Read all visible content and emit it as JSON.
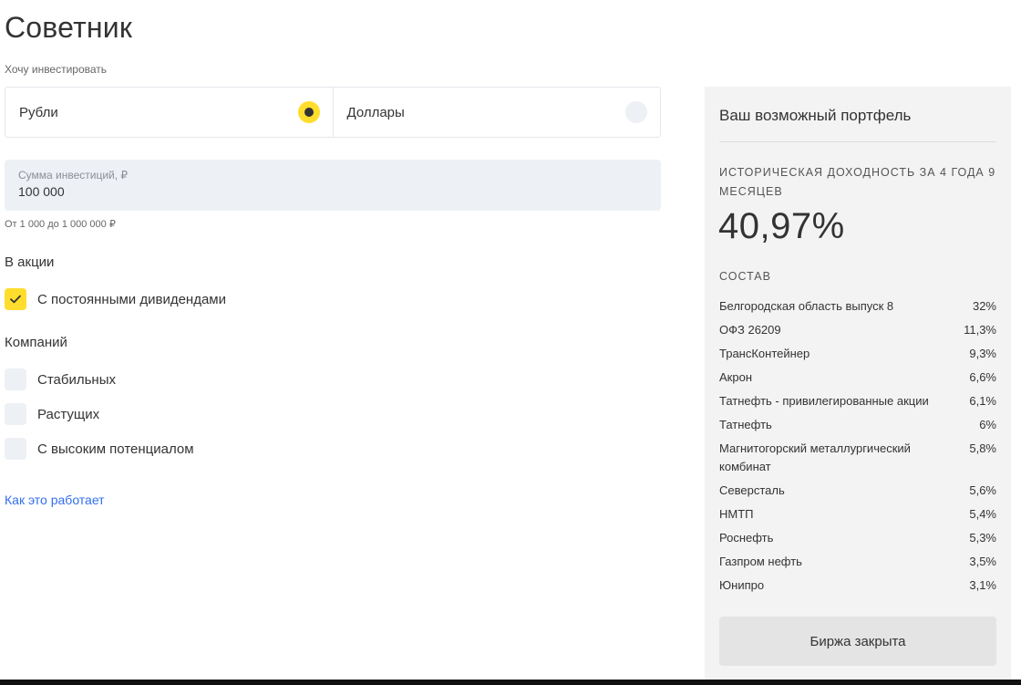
{
  "page": {
    "title": "Советник"
  },
  "invest": {
    "label": "Хочу инвестировать",
    "currencies": [
      {
        "label": "Рубли",
        "selected": true
      },
      {
        "label": "Доллары",
        "selected": false
      }
    ]
  },
  "amount": {
    "label": "Сумма инвестиций, ₽",
    "value": "100 000",
    "hint": "От 1 000 до 1 000 000 ₽"
  },
  "stocks": {
    "title": "В акции",
    "options": [
      {
        "label": "С постоянными дивидендами",
        "checked": true
      }
    ]
  },
  "companies": {
    "title": "Компаний",
    "options": [
      {
        "label": "Стабильных",
        "checked": false
      },
      {
        "label": "Растущих",
        "checked": false
      },
      {
        "label": "С высоким потенциалом",
        "checked": false
      }
    ]
  },
  "how_link": "Как это работает",
  "portfolio": {
    "title": "Ваш возможный портфель",
    "hist_label": "Историческая доходность за 4 года 9 месяцев",
    "hist_value": "40,97%",
    "composition_label": "Состав",
    "items": [
      {
        "name": "Белгородская область выпуск 8",
        "percent": "32%"
      },
      {
        "name": "ОФЗ 26209",
        "percent": "11,3%"
      },
      {
        "name": "ТрансКонтейнер",
        "percent": "9,3%"
      },
      {
        "name": "Акрон",
        "percent": "6,6%"
      },
      {
        "name": "Татнефть - привилегированные акции",
        "percent": "6,1%"
      },
      {
        "name": "Татнефть",
        "percent": "6%"
      },
      {
        "name": "Магнитогорский металлургический комбинат",
        "percent": "5,8%"
      },
      {
        "name": "Северсталь",
        "percent": "5,6%"
      },
      {
        "name": "НМТП",
        "percent": "5,4%"
      },
      {
        "name": "Роснефть",
        "percent": "5,3%"
      },
      {
        "name": "Газпром нефть",
        "percent": "3,5%"
      },
      {
        "name": "Юнипро",
        "percent": "3,1%"
      }
    ],
    "button_label": "Биржа закрыта"
  },
  "colors": {
    "accent_yellow": "#ffdd2d",
    "link_blue": "#336fee",
    "panel_bg": "#f3f3f3",
    "input_bg": "#edf1f6"
  },
  "icons": {
    "checkbox_checked": "checkmark-icon"
  }
}
